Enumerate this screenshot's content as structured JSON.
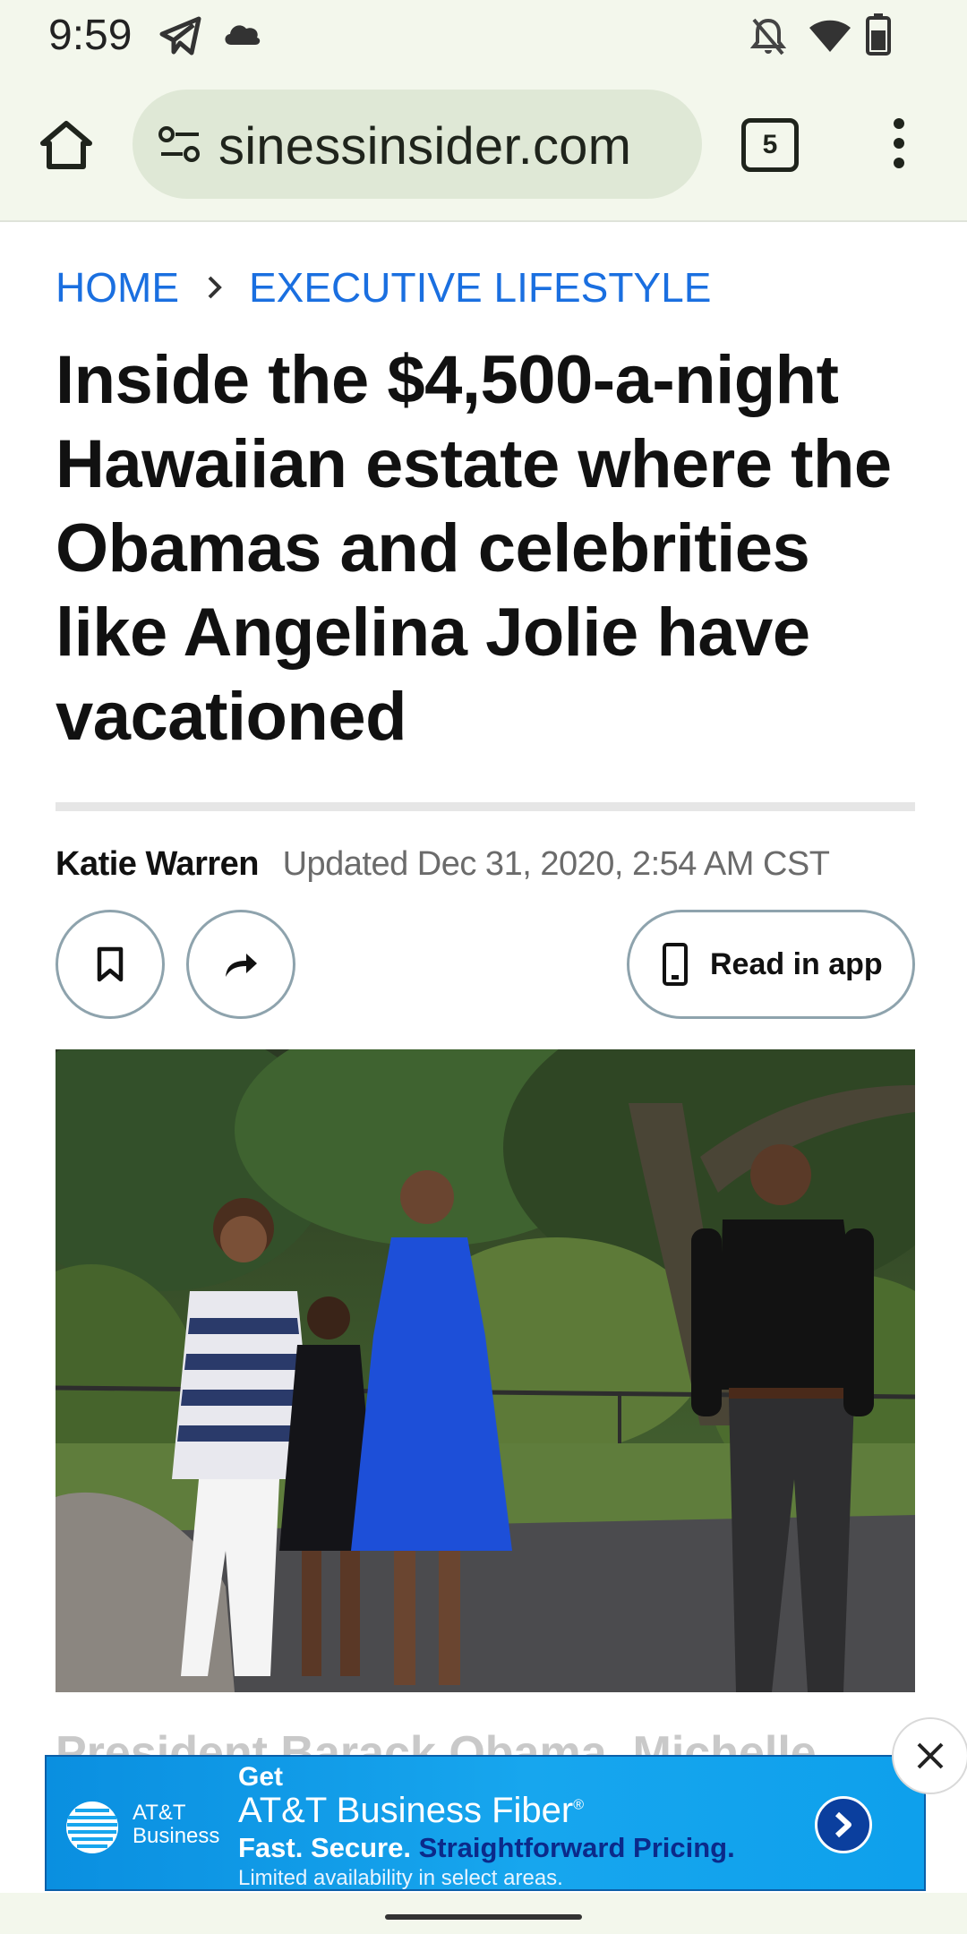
{
  "status_bar": {
    "time": "9:59",
    "icons": [
      "telegram-icon",
      "cloud-icon",
      "bell-off-icon",
      "wifi-icon",
      "battery-icon"
    ]
  },
  "browser": {
    "url": "sinessinsider.com",
    "tab_count": "5"
  },
  "breadcrumb": {
    "home": "HOME",
    "section": "EXECUTIVE LIFESTYLE"
  },
  "article": {
    "headline": "Inside the $4,500-a-night Hawaiian estate where the Obamas and celebrities like Angelina Jolie have vacationed",
    "author": "Katie Warren",
    "updated_label": "Updated",
    "updated_date": "Dec 31, 2020, 2:54 AM CST",
    "read_in_app_label": "Read in app",
    "caption_peek": "President Barack Obama, Michelle"
  },
  "ad": {
    "brand_line1": "AT&T",
    "brand_line2": "Business",
    "get": "Get",
    "product": "AT&T Business Fiber",
    "product_mark": "®",
    "tag_white": "Fast. Secure.",
    "tag_blue": "Straightforward Pricing.",
    "fine_print": "Limited availability in select areas."
  },
  "colors": {
    "link_blue": "#1a6fe0",
    "browser_bg": "#f3f7ec",
    "ad_blue": "#17a6ee"
  }
}
